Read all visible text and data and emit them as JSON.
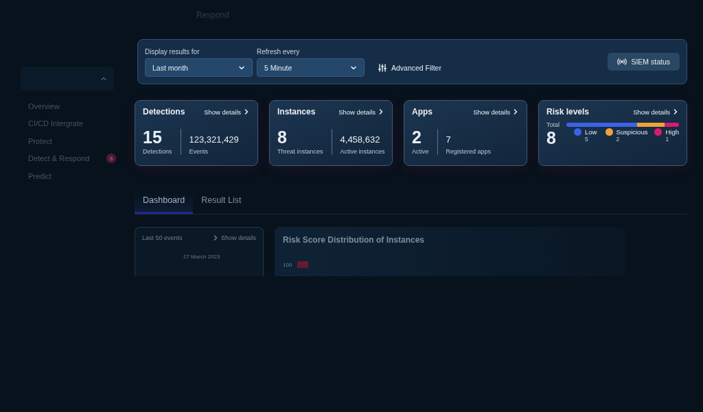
{
  "header": {
    "title": "Respond"
  },
  "sidebar": {
    "items": [
      {
        "label": "Overview"
      },
      {
        "label": "CI/CD Intergrate"
      },
      {
        "label": "Protect"
      },
      {
        "label": "Detect & Respond",
        "badge": "5"
      },
      {
        "label": "Predict"
      }
    ]
  },
  "filters": {
    "fields": [
      {
        "label": "Display results for",
        "value": "Last month"
      },
      {
        "label": "Refresh every",
        "value": "5 Minute"
      }
    ],
    "advanced": "Advanced Filter",
    "siem": "SIEM status"
  },
  "cards": [
    {
      "kind": "stats",
      "title": "Detections",
      "link": "Show details",
      "main": {
        "value": "15",
        "label": "Detections"
      },
      "secondary": {
        "value": "123,321,429",
        "label": "Events"
      }
    },
    {
      "kind": "stats",
      "title": "Instances",
      "link": "Show details",
      "main": {
        "value": "8",
        "label": "Threat instances"
      },
      "secondary": {
        "value": "4,458,632",
        "label": "Active instances"
      }
    },
    {
      "kind": "stats",
      "title": "Apps",
      "link": "Show details",
      "main": {
        "value": "2",
        "label": "Active"
      },
      "secondary": {
        "value": "7",
        "label": "Registered apps"
      }
    },
    {
      "kind": "risk",
      "title": "Risk levels",
      "link": "Show details",
      "total_label": "Total",
      "total": "8",
      "levels": [
        {
          "name": "Low",
          "count": "5",
          "color": "#3b63e8"
        },
        {
          "name": "Suspicious",
          "count": "2",
          "color": "#f0a23a"
        },
        {
          "name": "High",
          "count": "1",
          "color": "#d81b6e"
        }
      ]
    }
  ],
  "tabs": [
    {
      "label": "Dashboard",
      "selected": true
    },
    {
      "label": "Result List",
      "selected": false
    }
  ],
  "events_panel": {
    "title": "Last 50 events",
    "link": "Show details",
    "date": "27 March 2023"
  },
  "chart_panel": {
    "title": "Risk Score Distribution of Instances",
    "tick": "100"
  }
}
